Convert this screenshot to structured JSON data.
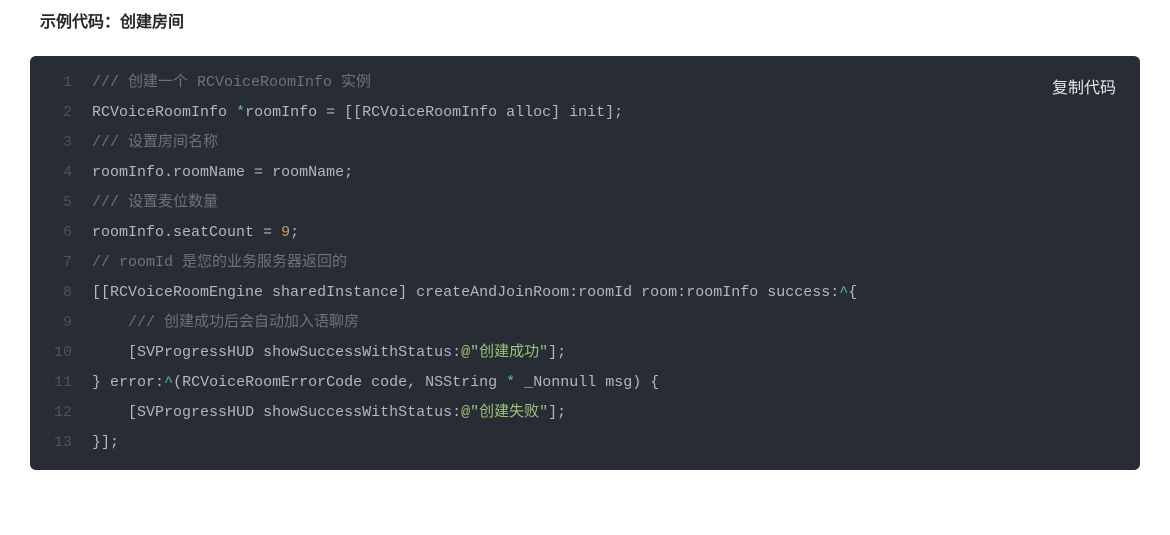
{
  "heading": "示例代码：创建房间",
  "copyLabel": "复制代码",
  "lineNumbers": [
    "1",
    "2",
    "3",
    "4",
    "5",
    "6",
    "7",
    "8",
    "9",
    "10",
    "11",
    "12",
    "13"
  ],
  "lines": [
    [
      [
        "comment",
        "/// 创建一个 RCVoiceRoomInfo 实例"
      ]
    ],
    [
      [
        "ident",
        "RCVoiceRoomInfo "
      ],
      [
        "op",
        "*"
      ],
      [
        "ident",
        "roomInfo "
      ],
      [
        "eq",
        "= "
      ],
      [
        "punct",
        "[["
      ],
      [
        "ident",
        "RCVoiceRoomInfo alloc"
      ],
      [
        "punct",
        "] "
      ],
      [
        "ident",
        "init"
      ],
      [
        "punct",
        "];"
      ]
    ],
    [
      [
        "comment",
        "/// 设置房间名称"
      ]
    ],
    [
      [
        "ident",
        "roomInfo.roomName "
      ],
      [
        "eq",
        "= "
      ],
      [
        "ident",
        "roomName"
      ],
      [
        "punct",
        ";"
      ]
    ],
    [
      [
        "comment",
        "/// 设置麦位数量"
      ]
    ],
    [
      [
        "ident",
        "roomInfo.seatCount "
      ],
      [
        "eq",
        "= "
      ],
      [
        "num",
        "9"
      ],
      [
        "punct",
        ";"
      ]
    ],
    [
      [
        "comment",
        "// roomId 是您的业务服务器返回的"
      ]
    ],
    [
      [
        "punct",
        "[["
      ],
      [
        "ident",
        "RCVoiceRoomEngine sharedInstance"
      ],
      [
        "punct",
        "] "
      ],
      [
        "ident",
        "createAndJoinRoom"
      ],
      [
        "punct",
        ":"
      ],
      [
        "ident",
        "roomId room"
      ],
      [
        "punct",
        ":"
      ],
      [
        "ident",
        "roomInfo success"
      ],
      [
        "punct",
        ":"
      ],
      [
        "op",
        "^"
      ],
      [
        "punct",
        "{"
      ]
    ],
    [
      [
        "ident",
        "    "
      ],
      [
        "comment",
        "/// 创建成功后会自动加入语聊房"
      ]
    ],
    [
      [
        "ident",
        "    "
      ],
      [
        "punct",
        "["
      ],
      [
        "ident",
        "SVProgressHUD showSuccessWithStatus"
      ],
      [
        "punct",
        ":"
      ],
      [
        "string",
        "@\"创建成功\""
      ],
      [
        "punct",
        "];"
      ]
    ],
    [
      [
        "punct",
        "} "
      ],
      [
        "ident",
        "error"
      ],
      [
        "punct",
        ":"
      ],
      [
        "op",
        "^"
      ],
      [
        "punct",
        "("
      ],
      [
        "ident",
        "RCVoiceRoomErrorCode code"
      ],
      [
        "punct",
        ", "
      ],
      [
        "ident",
        "NSString "
      ],
      [
        "op",
        "*"
      ],
      [
        "ident",
        " _Nonnull msg"
      ],
      [
        "punct",
        ") {"
      ]
    ],
    [
      [
        "ident",
        "    "
      ],
      [
        "punct",
        "["
      ],
      [
        "ident",
        "SVProgressHUD showSuccessWithStatus"
      ],
      [
        "punct",
        ":"
      ],
      [
        "string",
        "@\"创建失败\""
      ],
      [
        "punct",
        "];"
      ]
    ],
    [
      [
        "punct",
        "}];"
      ]
    ]
  ]
}
